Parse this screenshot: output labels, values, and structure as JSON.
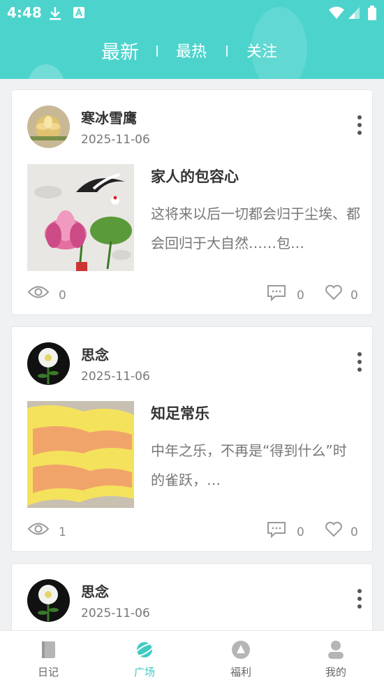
{
  "status_bar": {
    "time": "4:48"
  },
  "tabs": [
    {
      "label": "最新",
      "active": true
    },
    {
      "label": "最热",
      "active": false
    },
    {
      "label": "关注",
      "active": false
    }
  ],
  "posts": [
    {
      "username": "寒冰雪鹰",
      "date": "2025-11-06",
      "title": "家人的包容心",
      "excerpt": "这将来以后一切都会归于尘埃、都会回归于大自然……包…",
      "views": "0",
      "comments": "0",
      "likes": "0"
    },
    {
      "username": "思念",
      "date": "2025-11-06",
      "title": "知足常乐",
      "excerpt": "中年之乐，不再是“得到什么”时的雀跃，…",
      "views": "1",
      "comments": "0",
      "likes": "0"
    },
    {
      "username": "思念",
      "date": "2025-11-06"
    }
  ],
  "bottom_nav": [
    {
      "label": "日记",
      "icon": "diary-icon",
      "active": false
    },
    {
      "label": "广场",
      "icon": "plaza-icon",
      "active": true
    },
    {
      "label": "福利",
      "icon": "benefits-icon",
      "active": false
    },
    {
      "label": "我的",
      "icon": "profile-icon",
      "active": false
    }
  ],
  "colors": {
    "accent": "#4cd3cc",
    "active_nav": "#3ecbc3"
  }
}
